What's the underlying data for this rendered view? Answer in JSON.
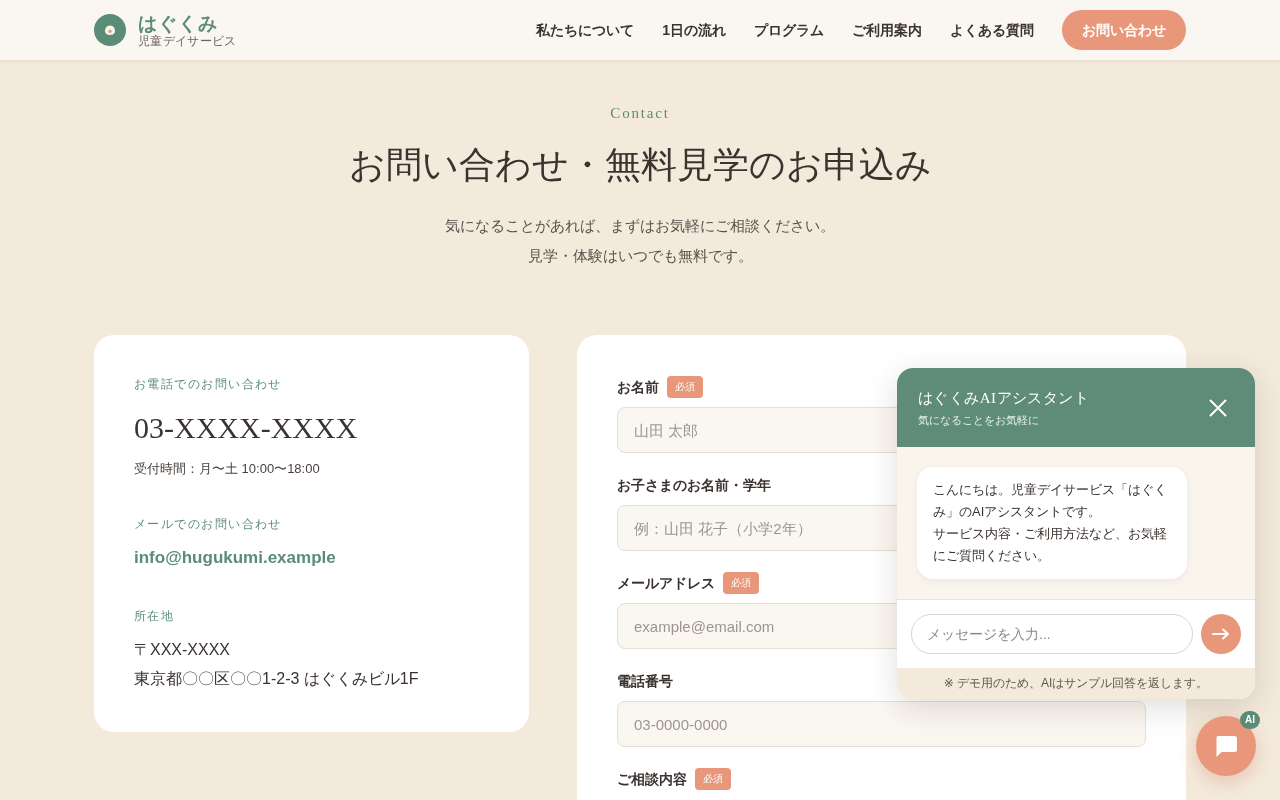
{
  "header": {
    "brand": {
      "name": "はぐくみ",
      "tagline": "児童デイサービス"
    },
    "nav": [
      {
        "label": "私たちについて"
      },
      {
        "label": "1日の流れ"
      },
      {
        "label": "プログラム"
      },
      {
        "label": "ご利用案内"
      },
      {
        "label": "よくある質問"
      }
    ],
    "cta": "お問い合わせ"
  },
  "intro": {
    "eyebrow": "Contact",
    "title": "お問い合わせ・無料見学のお申込み",
    "lead": [
      "気になることがあれば、まずはお気軽にご相談ください。",
      "見学・体験はいつでも無料です。"
    ]
  },
  "contact_info": [
    {
      "kind": "phone",
      "heading": "お電話でのお問い合わせ",
      "value": "03-XXXX-XXXX",
      "note": "受付時間：月〜土 10:00〜18:00"
    },
    {
      "kind": "email",
      "heading": "メールでのお問い合わせ",
      "value": "info@hugukumi.example"
    },
    {
      "kind": "address",
      "heading": "所在地",
      "value": "〒XXX-XXXX\n東京都〇〇区〇〇1-2-3 はぐくみビル1F"
    }
  ],
  "form": {
    "fields": [
      {
        "label": "お名前",
        "required_badge": "必須",
        "placeholder": "山田 太郎"
      },
      {
        "label": "お子さまのお名前・学年",
        "placeholder": "例：山田 花子（小学2年）"
      },
      {
        "label": "メールアドレス",
        "required_badge": "必須",
        "placeholder": "example@email.com"
      },
      {
        "label": "電話番号",
        "placeholder": "03-0000-0000"
      },
      {
        "label": "ご相談内容",
        "required_badge": "必須"
      }
    ]
  },
  "chat": {
    "title": "はぐくみAIアシスタント",
    "subtitle": "気になることをお気軽に",
    "messages": [
      {
        "paragraphs": [
          "こんにちは。児童デイサービス「はぐくみ」のAIアシスタントです。",
          "サービス内容・ご利用方法など、お気軽にご質問ください。"
        ]
      }
    ],
    "input_placeholder": "メッセージを入力...",
    "footer_note": "※ デモ用のため、AIはサンプル回答を返します。"
  },
  "chat_launcher": {
    "badge": "AI"
  }
}
